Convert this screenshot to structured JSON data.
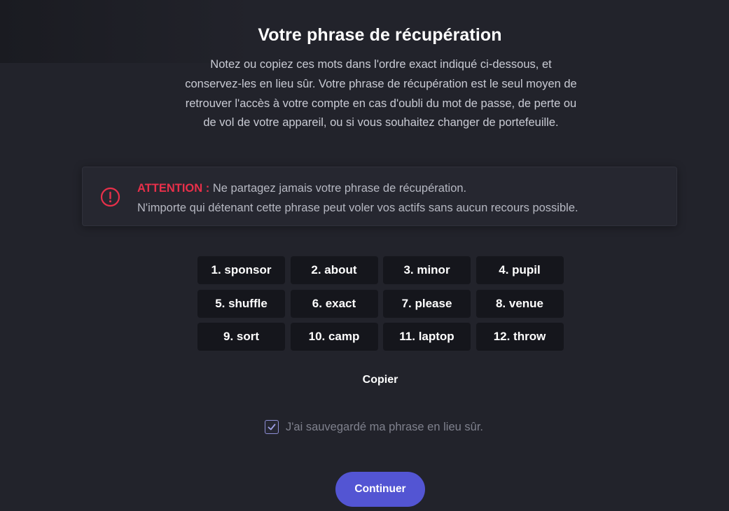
{
  "header": {
    "title": "Votre phrase de récupération",
    "description": "Notez ou copiez ces mots dans l'ordre exact indiqué ci-dessous, et conservez-les en lieu sûr. Votre phrase de récupération est le seul moyen de retrouver l'accès à votre compte en cas d'oubli du mot de passe, de perte ou de vol de votre appareil, ou si vous souhaitez changer de portefeuille."
  },
  "warning": {
    "icon": "alert-circle-icon",
    "label": "ATTENTION :",
    "line1": " Ne partagez jamais votre phrase de récupération.",
    "line2": "N'importe qui détenant cette phrase peut voler vos actifs sans aucun recours possible.",
    "accent_color": "#e8304a"
  },
  "seed_words": [
    "1. sponsor",
    "2. about",
    "3. minor",
    "4. pupil",
    "5. shuffle",
    "6. exact",
    "7. please",
    "8. venue",
    "9. sort",
    "10. camp",
    "11. laptop",
    "12. throw"
  ],
  "actions": {
    "copy_label": "Copier",
    "confirm_label": "J'ai sauvegardé ma phrase en lieu sûr.",
    "confirm_checked": true,
    "continue_label": "Continuer"
  },
  "colors": {
    "background": "#22232b",
    "chip": "#15161c",
    "primary": "#5355d3",
    "checkbox_border": "#8e8fd6"
  }
}
